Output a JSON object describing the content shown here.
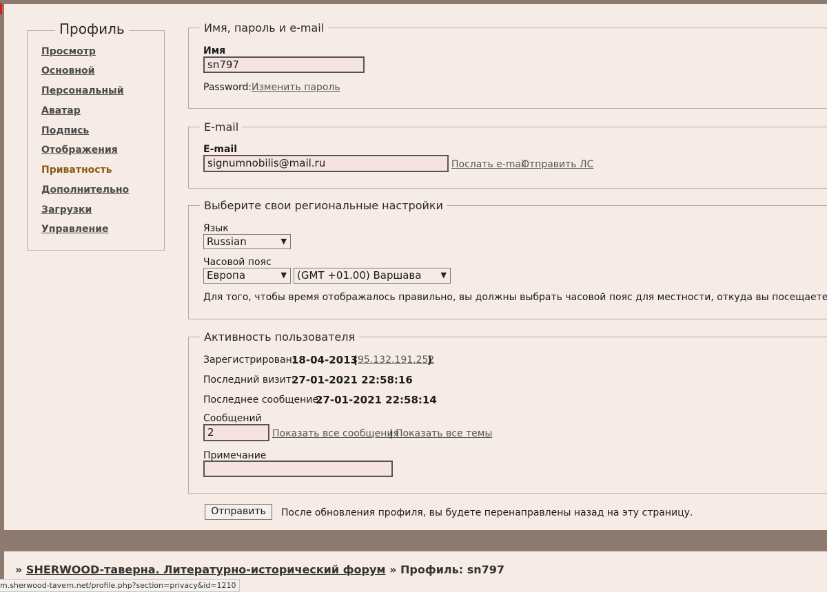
{
  "profile_menu": {
    "title": "Профиль",
    "items": [
      {
        "label": "Просмотр",
        "active": false
      },
      {
        "label": "Основной",
        "active": false
      },
      {
        "label": "Персональный",
        "active": false
      },
      {
        "label": "Аватар",
        "active": false
      },
      {
        "label": "Подпись",
        "active": false
      },
      {
        "label": "Отображения",
        "active": false
      },
      {
        "label": "Приватность",
        "active": true
      },
      {
        "label": "Дополнительно",
        "active": false
      },
      {
        "label": "Загрузки",
        "active": false
      },
      {
        "label": "Управление",
        "active": false
      }
    ]
  },
  "name_section": {
    "legend": "Имя, пароль и e-mail",
    "name_label": "Имя",
    "name_value": "sn797",
    "password_label": "Password:",
    "change_password_link": "Изменить пароль"
  },
  "email_section": {
    "legend": "E-mail",
    "email_label": "E-mail",
    "email_value": "signumnobilis@mail.ru",
    "send_email_link": "Послать e-mail",
    "send_pm_link": "Отправить ЛС"
  },
  "regional_section": {
    "legend": "Выберите свои региональные настройки",
    "language_label": "Язык",
    "language_value": "Russian",
    "timezone_label": "Часовой пояс",
    "timezone_region": "Европа",
    "timezone_city": "(GMT +01.00) Варшава",
    "timezone_hint": "Для того, чтобы время отображалось правильно, вы должны выбрать часовой пояс для местности, откуда вы посещаете форум."
  },
  "activity_section": {
    "legend": "Активность пользователя",
    "registered_label": "Зарегистрирован:",
    "registered_date": "18-04-2013",
    "registered_ip": "95.132.191.252",
    "last_visit_label": "Последний визит:",
    "last_visit_value": "27-01-2021 22:58:16",
    "last_post_label": "Последнее сообщение:",
    "last_post_value": "27-01-2021 22:58:14",
    "posts_label": "Сообщений",
    "posts_value": "2",
    "show_all_posts_link": "Показать все сообщения",
    "separator": "|",
    "show_all_topics_link": "Показать все темы",
    "note_label": "Примечание",
    "note_value": ""
  },
  "submit": {
    "button_label": "Отправить",
    "hint": "После обновления профиля, вы будете перенаправлены назад на эту страницу."
  },
  "breadcrumb": {
    "prefix": "»",
    "forum_link": "SHERWOOD-таверна. Литературно-исторический форум",
    "separator": "»",
    "current": "Профиль: sn797"
  },
  "status_bar": {
    "url": "m.sherwood-tavern.net/profile.php?section=privacy&id=1210"
  },
  "colors": {
    "page_bg": "#f6ebe5",
    "frame": "#8c7b6e",
    "active_menu": "#8c5a12",
    "link": "#555555",
    "input_bg": "#f6e3e1"
  }
}
